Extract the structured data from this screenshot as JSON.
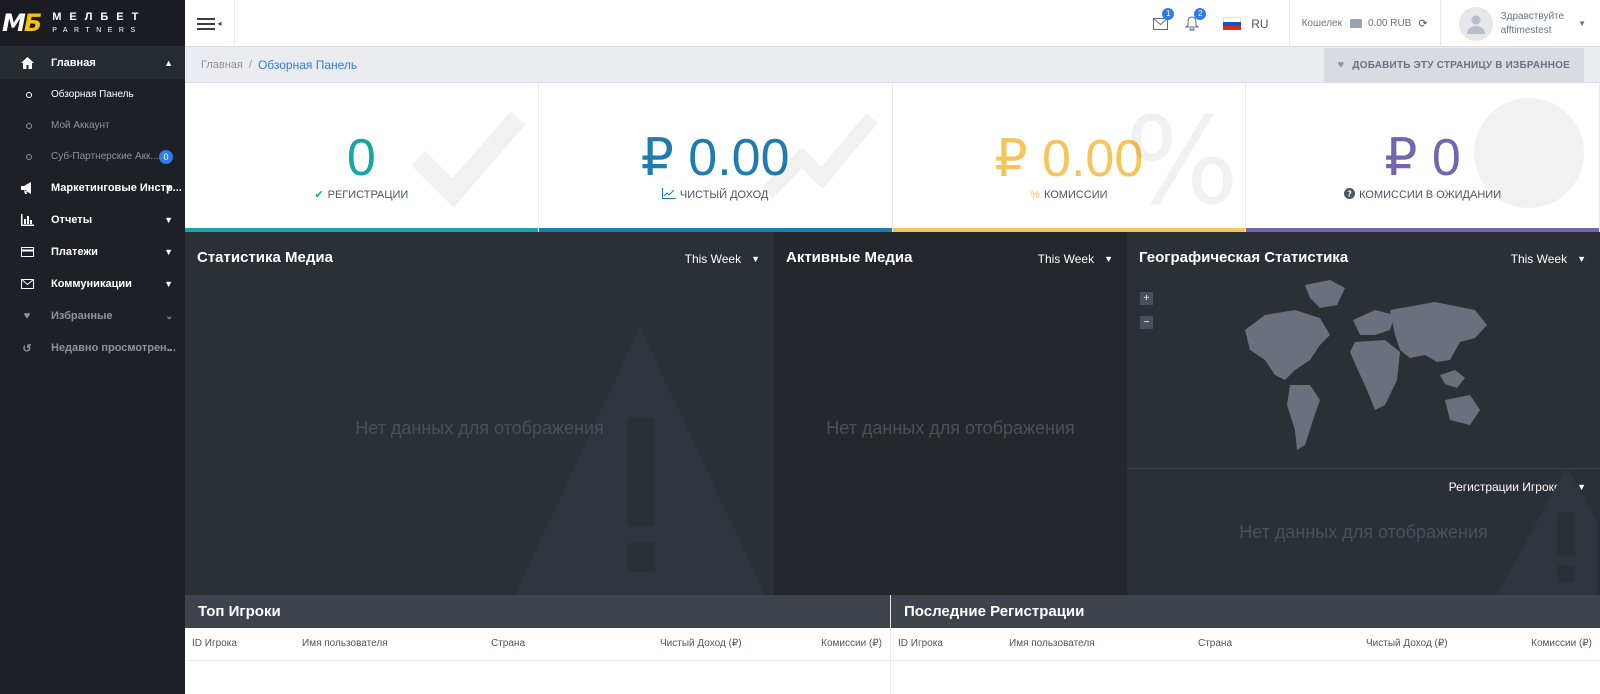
{
  "brand": {
    "logo_mark_1": "М",
    "logo_mark_2": "Б",
    "logo_line1": "МЕЛБЕТ",
    "logo_line2": "PARTNERS"
  },
  "sidebar": {
    "items": [
      {
        "label": "Главная"
      },
      {
        "label": "Маркетинговые Инстр..."
      },
      {
        "label": "Отчеты"
      },
      {
        "label": "Платежи"
      },
      {
        "label": "Коммуникации"
      },
      {
        "label": "Избранные"
      },
      {
        "label": "Недавно просмотрен..."
      }
    ],
    "subitems": [
      {
        "label": "Обзорная Панель"
      },
      {
        "label": "Мой Аккаунт"
      },
      {
        "label": "Суб-Партнерские Акк...",
        "badge": "0"
      }
    ]
  },
  "topbar": {
    "mail_count": "1",
    "bell_count": "2",
    "language": "RU",
    "wallet_label": "Кошелек",
    "wallet_value": "0.00 RUB",
    "greeting": "Здравствуйте",
    "username": "afftimestest"
  },
  "breadcrumb": {
    "home": "Главная",
    "separator": "/",
    "current": "Обзорная Панель"
  },
  "favorite_button": "ДОБАВИТЬ ЭТУ СТРАНИЦУ В ИЗБРАННОЕ",
  "stats": [
    {
      "value": "0",
      "label": "РЕГИСТРАЦИИ",
      "color": "#16a6a6",
      "icon": "check-icon"
    },
    {
      "value": "₽ 0.00",
      "label": "ЧИСТЫЙ ДОХОД",
      "color": "#1f7bb0",
      "icon": "chart-line-icon"
    },
    {
      "value": "₽ 0.00",
      "label": "КОМИССИИ",
      "color": "#f5c55a",
      "icon": "percent-icon",
      "icon_text": "%"
    },
    {
      "value": "₽ 0",
      "label": "КОМИССИИ В ОЖИДАНИИ",
      "color": "#7466ae",
      "icon": "question-circle-icon"
    }
  ],
  "panels": {
    "media_stats": {
      "title": "Статистика Медиа",
      "period": "This Week",
      "empty": "Нет данных для отображения"
    },
    "active_media": {
      "title": "Активные Медиа",
      "period": "This Week",
      "empty": "Нет данных для отображения"
    },
    "geo_stats": {
      "title": "Географическая Статистика",
      "period": "This Week",
      "zoom_in": "+",
      "zoom_out": "−",
      "metric": "Регистрации Игроков",
      "empty": "Нет данных для отображения"
    }
  },
  "tables": {
    "top_players": {
      "title": "Топ Игроки",
      "columns": [
        "ID Игрока",
        "Имя пользователя",
        "Страна",
        "Чистый Доход (₽)",
        "Комиссии (₽)"
      ]
    },
    "recent_regs": {
      "title": "Последние Регистрации",
      "columns": [
        "ID Игрока",
        "Имя пользователя",
        "Страна",
        "Чистый Доход (₽)",
        "Комиссии (₽)"
      ]
    }
  }
}
